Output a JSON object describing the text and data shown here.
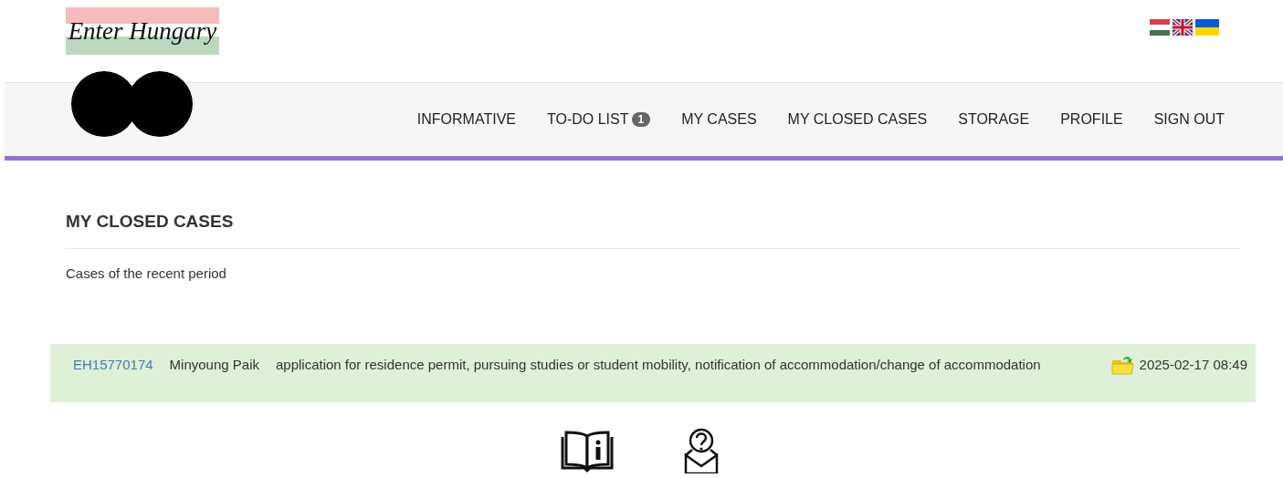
{
  "logo": {
    "text": "Enter Hungary"
  },
  "languages": [
    {
      "kind": "hungary"
    },
    {
      "kind": "uk"
    },
    {
      "kind": "ukraine"
    }
  ],
  "nav": [
    {
      "label": "INFORMATIVE",
      "selected": false
    },
    {
      "label": "TO-DO LIST",
      "badge": "1",
      "selected": false
    },
    {
      "label": "MY CASES",
      "selected": false
    },
    {
      "label": "MY CLOSED CASES",
      "selected": false
    },
    {
      "label": "STORAGE",
      "selected": false
    },
    {
      "label": "PROFILE",
      "selected": false
    },
    {
      "label": "SIGN OUT",
      "selected": false
    }
  ],
  "page_title": "MY CLOSED CASES",
  "subtitle": "Cases of the recent period",
  "cases": [
    {
      "id": "EH15770174",
      "name": "Minyoung Paik",
      "description": "application for residence permit, pursuing studies or student mobility, notification of accommodation/change of accommodation",
      "date": "2025-02-17 08:49"
    }
  ],
  "footer_icons": [
    {
      "kind": "manual"
    },
    {
      "kind": "help"
    }
  ]
}
